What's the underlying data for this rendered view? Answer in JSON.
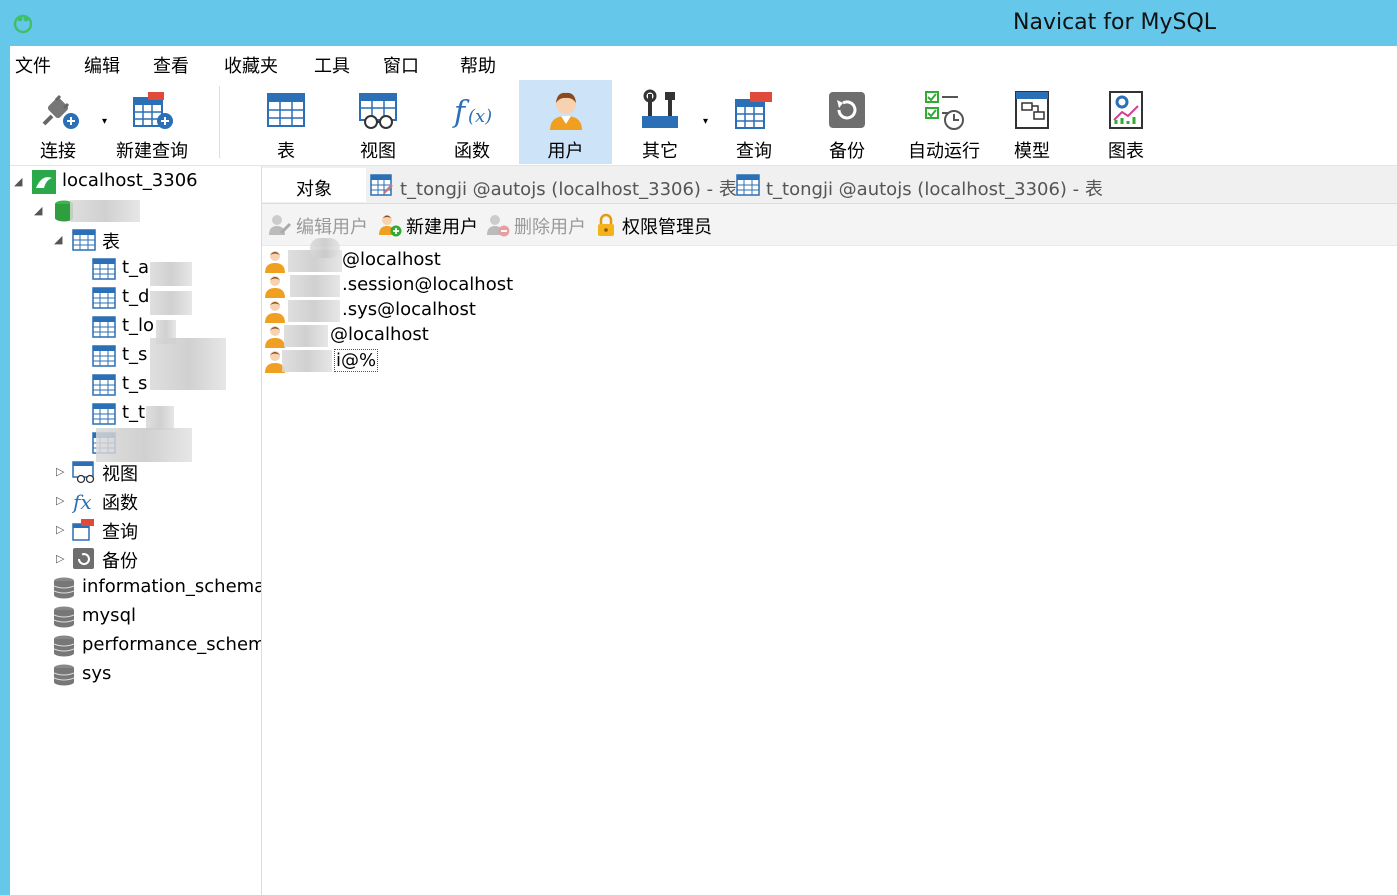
{
  "window": {
    "title": "Navicat for MySQL"
  },
  "menu": [
    "文件",
    "编辑",
    "查看",
    "收藏夹",
    "工具",
    "窗口",
    "帮助"
  ],
  "toolbar": {
    "buttons": [
      {
        "label": "连接",
        "icon": "connect-icon"
      },
      {
        "label": "新建查询",
        "icon": "new-query-icon"
      },
      {
        "label": "表",
        "icon": "table-icon"
      },
      {
        "label": "视图",
        "icon": "view-icon"
      },
      {
        "label": "函数",
        "icon": "function-icon"
      },
      {
        "label": "用户",
        "icon": "user-icon",
        "active": true
      },
      {
        "label": "其它",
        "icon": "tools-icon"
      },
      {
        "label": "查询",
        "icon": "query-icon"
      },
      {
        "label": "备份",
        "icon": "backup-icon"
      },
      {
        "label": "自动运行",
        "icon": "schedule-icon"
      },
      {
        "label": "模型",
        "icon": "model-icon"
      },
      {
        "label": "图表",
        "icon": "chart-icon"
      }
    ]
  },
  "sidebar": {
    "connection": "localhost_3306",
    "tables_label": "表",
    "tables": [
      "t_a",
      "t_d",
      "t_lo",
      "t_s",
      "t_s",
      "t_t"
    ],
    "groups": [
      "视图",
      "函数",
      "查询",
      "备份"
    ],
    "databases": [
      "information_schema",
      "mysql",
      "performance_schema",
      "sys"
    ]
  },
  "tabs": {
    "objects": "对象",
    "open": [
      "t_tongji @autojs (localhost_3306) - 表",
      "t_tongji @autojs (localhost_3306) - 表"
    ]
  },
  "object_toolbar": {
    "edit_user": "编辑用户",
    "new_user": "新建用户",
    "delete_user": "删除用户",
    "privilege_manager": "权限管理员"
  },
  "users": [
    "@localhost",
    ".session@localhost",
    ".sys@localhost",
    "@localhost",
    "i@%"
  ],
  "colors": {
    "titlebar": "#65c8ea",
    "active_tool": "#cde3f8",
    "accent_blue": "#2b6fb6",
    "user_orange": "#f0a020"
  }
}
